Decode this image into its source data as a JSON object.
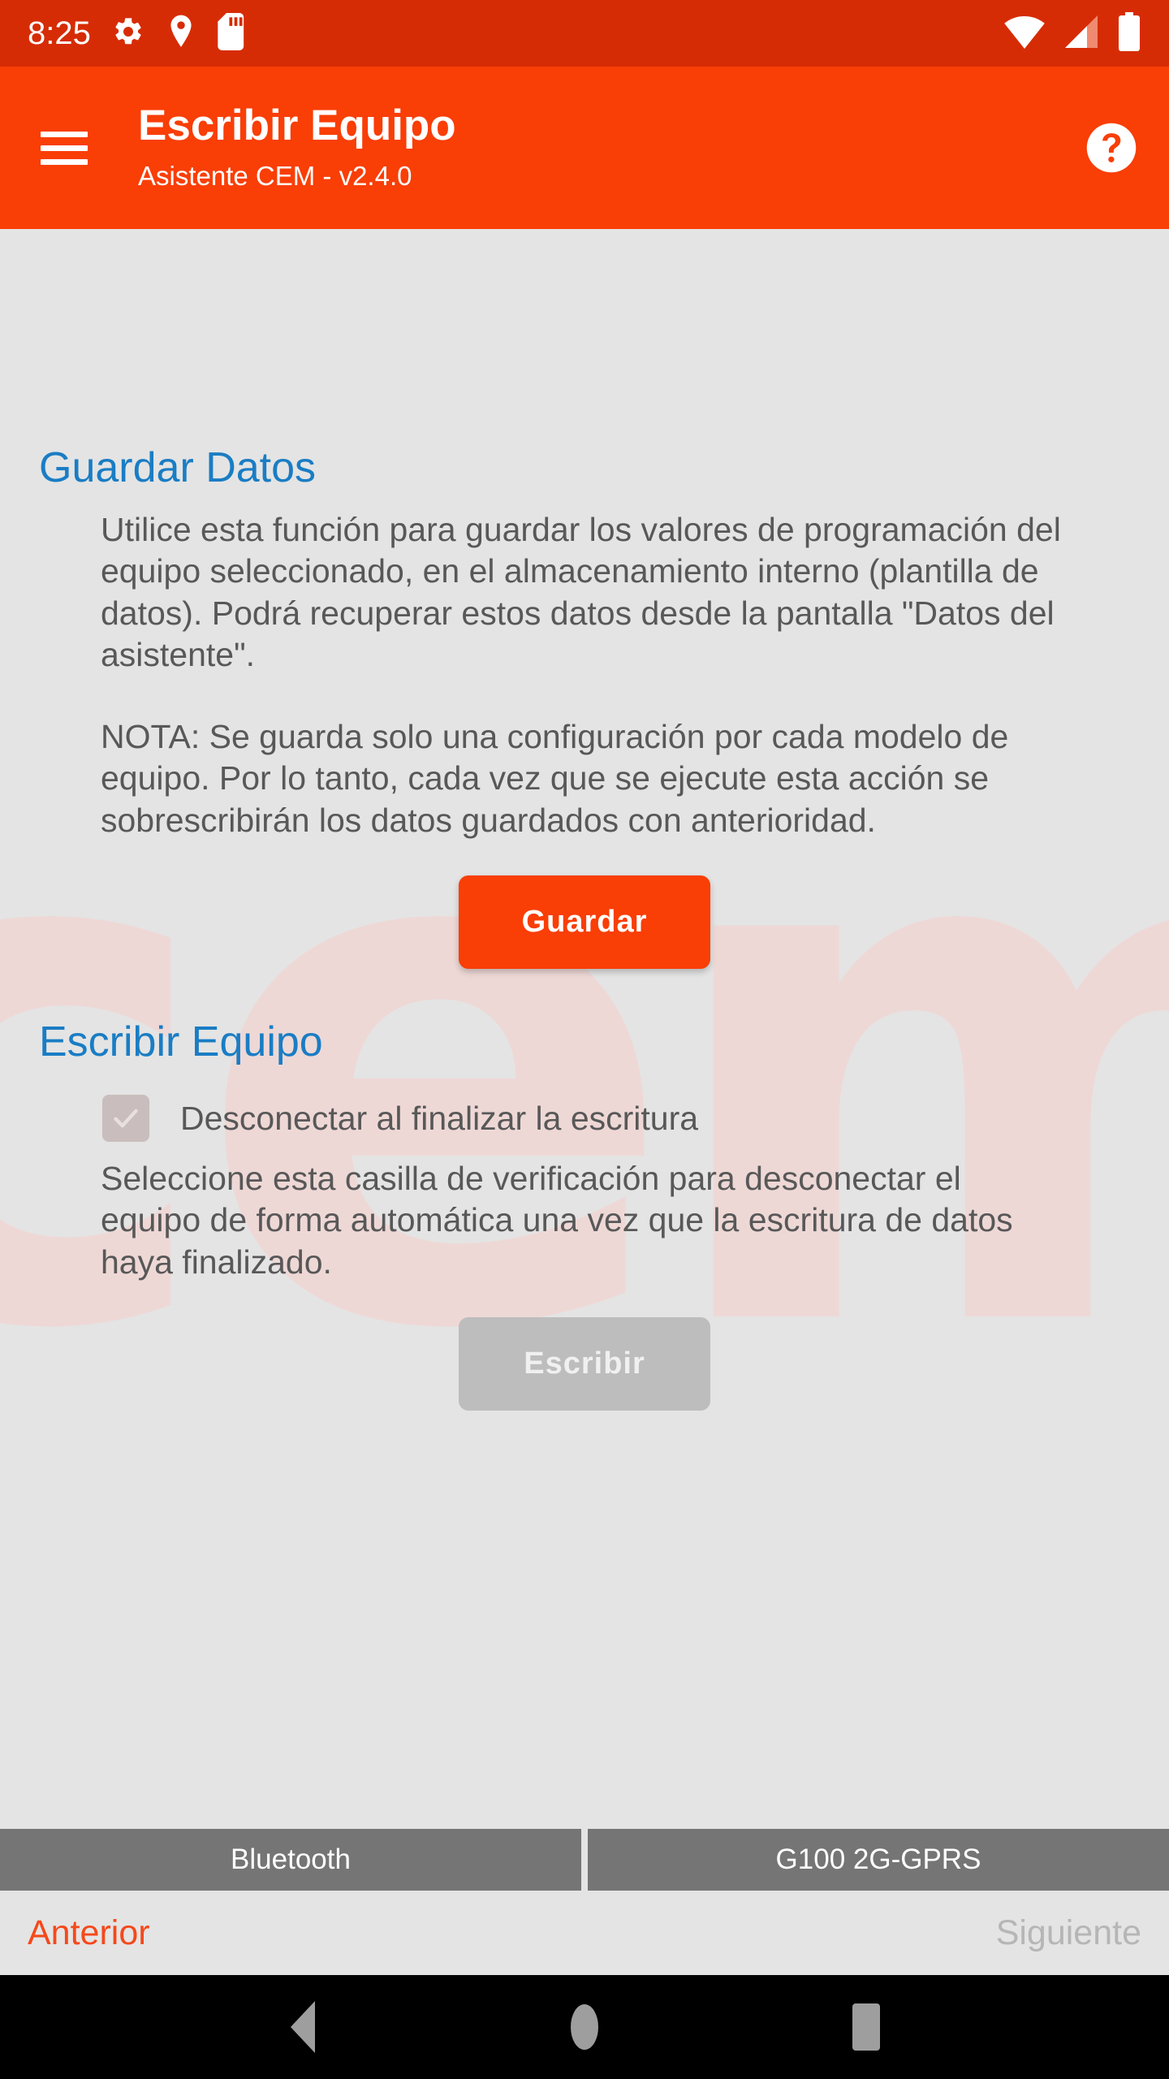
{
  "status_bar": {
    "time": "8:25",
    "left_icons": [
      "gear-icon",
      "location-pin-icon",
      "sd-card-icon"
    ],
    "right_icons": [
      "wifi-icon",
      "cellular-signal-icon",
      "battery-icon"
    ],
    "background_color": "#d62c05"
  },
  "app_bar": {
    "menu_icon": "hamburger-menu-icon",
    "title": "Escribir Equipo",
    "subtitle": "Asistente CEM - v2.4.0",
    "help_icon": "help-circle-icon",
    "background_color": "#f93e06"
  },
  "watermark": {
    "text": "cem",
    "color": "#f0d6d4"
  },
  "sections": {
    "guardar": {
      "heading": "Guardar Datos",
      "heading_color": "#1a7dc4",
      "paragraph_1": "Utilice esta función para guardar los valores de programación del equipo seleccionado, en el almacenamiento interno (plantilla de datos). Podrá recuperar estos datos desde la pantalla \"Datos del asistente\".",
      "paragraph_2": "NOTA: Se guarda solo una configuración por cada modelo de equipo. Por lo tanto, cada vez que se ejecute esta acción se sobrescribirán los datos guardados con anterioridad.",
      "button_label": "Guardar",
      "button_color": "#f93e06"
    },
    "escribir": {
      "heading": "Escribir Equipo",
      "heading_color": "#1a7dc4",
      "checkbox_label": "Desconectar al finalizar la escritura",
      "checkbox_checked": "true",
      "checkbox_enabled": "false",
      "paragraph": "Seleccione esta casilla de verificación para desconectar el equipo de forma automática una vez que la escritura de datos haya finalizado.",
      "button_label": "Escribir",
      "button_enabled": "false",
      "button_color": "#bdbdbd"
    }
  },
  "device_bar": {
    "connection": "Bluetooth",
    "device_model": "G100 2G-GPRS",
    "background_color": "#757575"
  },
  "wizard_nav": {
    "previous_label": "Anterior",
    "previous_color": "#f4491b",
    "next_label": "Siguiente",
    "next_color": "#b6b6b6",
    "next_enabled": "false"
  },
  "android_nav": {
    "back": "back-triangle-icon",
    "home": "home-circle-icon",
    "recents": "recents-square-icon"
  }
}
